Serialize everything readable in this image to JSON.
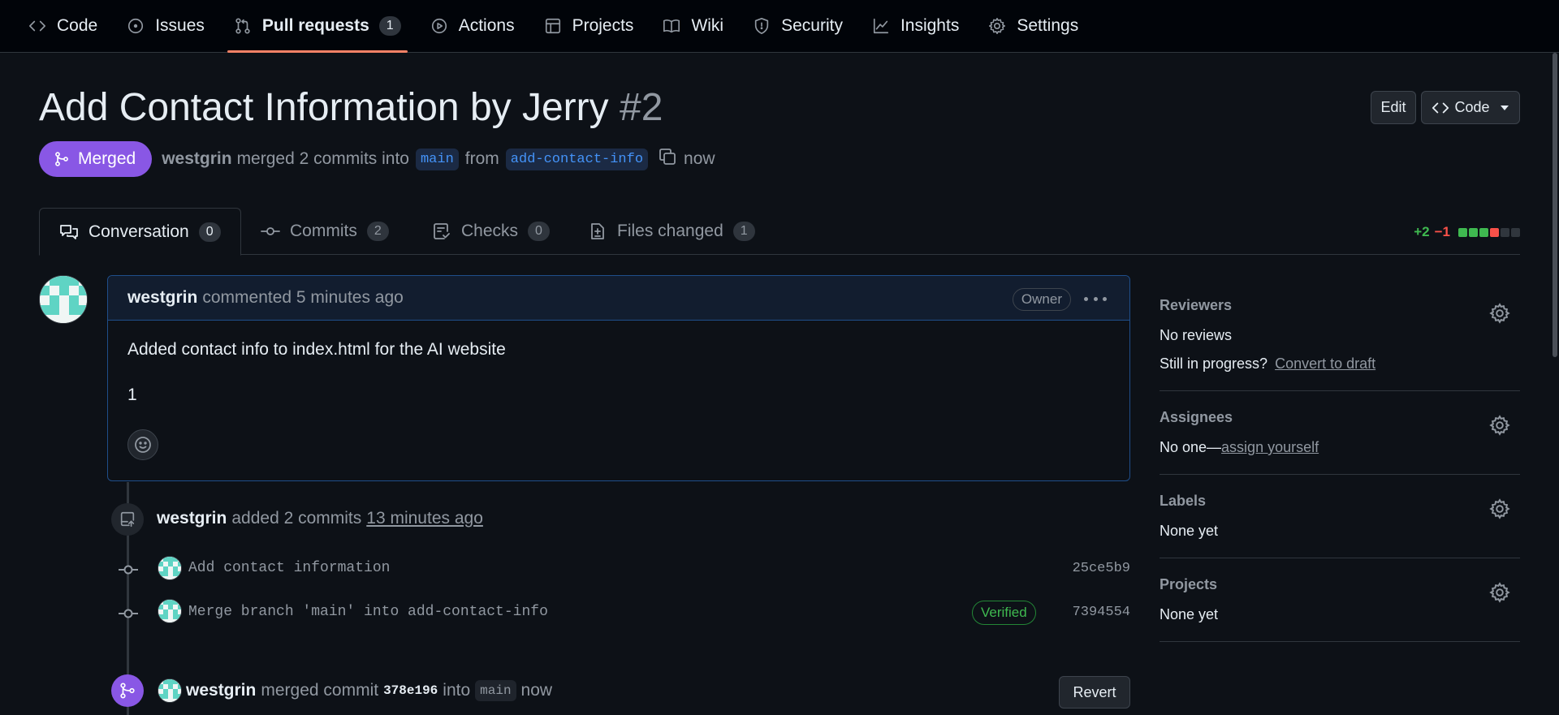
{
  "nav": {
    "items": [
      {
        "label": "Code",
        "icon": "code-icon"
      },
      {
        "label": "Issues",
        "icon": "issue-icon"
      },
      {
        "label": "Pull requests",
        "icon": "pull-request-icon",
        "count": "1"
      },
      {
        "label": "Actions",
        "icon": "play-icon"
      },
      {
        "label": "Projects",
        "icon": "table-icon"
      },
      {
        "label": "Wiki",
        "icon": "book-icon"
      },
      {
        "label": "Security",
        "icon": "shield-icon"
      },
      {
        "label": "Insights",
        "icon": "graph-icon"
      },
      {
        "label": "Settings",
        "icon": "gear-icon"
      }
    ],
    "active": "Pull requests"
  },
  "header": {
    "title": "Add Contact Information by Jerry",
    "number": "#2",
    "edit_label": "Edit",
    "code_label": "Code"
  },
  "meta": {
    "state": "Merged",
    "author": "westgrin",
    "action": "merged 2 commits into",
    "base": "main",
    "from_word": "from",
    "head": "add-contact-info",
    "time": "now"
  },
  "tabs": [
    {
      "label": "Conversation",
      "count": "0",
      "icon": "comment-discussion-icon"
    },
    {
      "label": "Commits",
      "count": "2",
      "icon": "git-commit-icon"
    },
    {
      "label": "Checks",
      "count": "0",
      "icon": "checklist-icon"
    },
    {
      "label": "Files changed",
      "count": "1",
      "icon": "file-diff-icon"
    }
  ],
  "diffstat": {
    "additions": "+2",
    "deletions": "−1",
    "colors": [
      "#3fb950",
      "#3fb950",
      "#3fb950",
      "#f85149",
      "#30363d",
      "#30363d"
    ]
  },
  "comment": {
    "author": "westgrin",
    "action": "commented 5 minutes ago",
    "badge": "Owner",
    "body_line1": "Added contact info to index.html for the AI website",
    "body_line2": "1"
  },
  "timeline": {
    "added": {
      "author": "westgrin",
      "action": "added 2 commits",
      "time": "13 minutes ago"
    },
    "commits": [
      {
        "message": "Add contact information",
        "sha": "25ce5b9"
      },
      {
        "message": "Merge branch 'main' into add-contact-info",
        "sha": "7394554",
        "verified": "Verified"
      }
    ],
    "merged": {
      "author": "westgrin",
      "action": "merged commit",
      "sha": "378e196",
      "into_word": "into",
      "base": "main",
      "time": "now",
      "revert_label": "Revert"
    }
  },
  "sidebar": {
    "reviewers": {
      "title": "Reviewers",
      "value": "No reviews",
      "progress_text": "Still in progress?",
      "progress_link": "Convert to draft"
    },
    "assignees": {
      "title": "Assignees",
      "value": "No one—",
      "link": "assign yourself"
    },
    "labels": {
      "title": "Labels",
      "value": "None yet"
    },
    "projects": {
      "title": "Projects",
      "value": "None yet"
    }
  },
  "colors": {
    "merged": "#8957e5",
    "accent_underline": "#f78166",
    "link": "#4493f8",
    "verified": "#3fb950"
  }
}
